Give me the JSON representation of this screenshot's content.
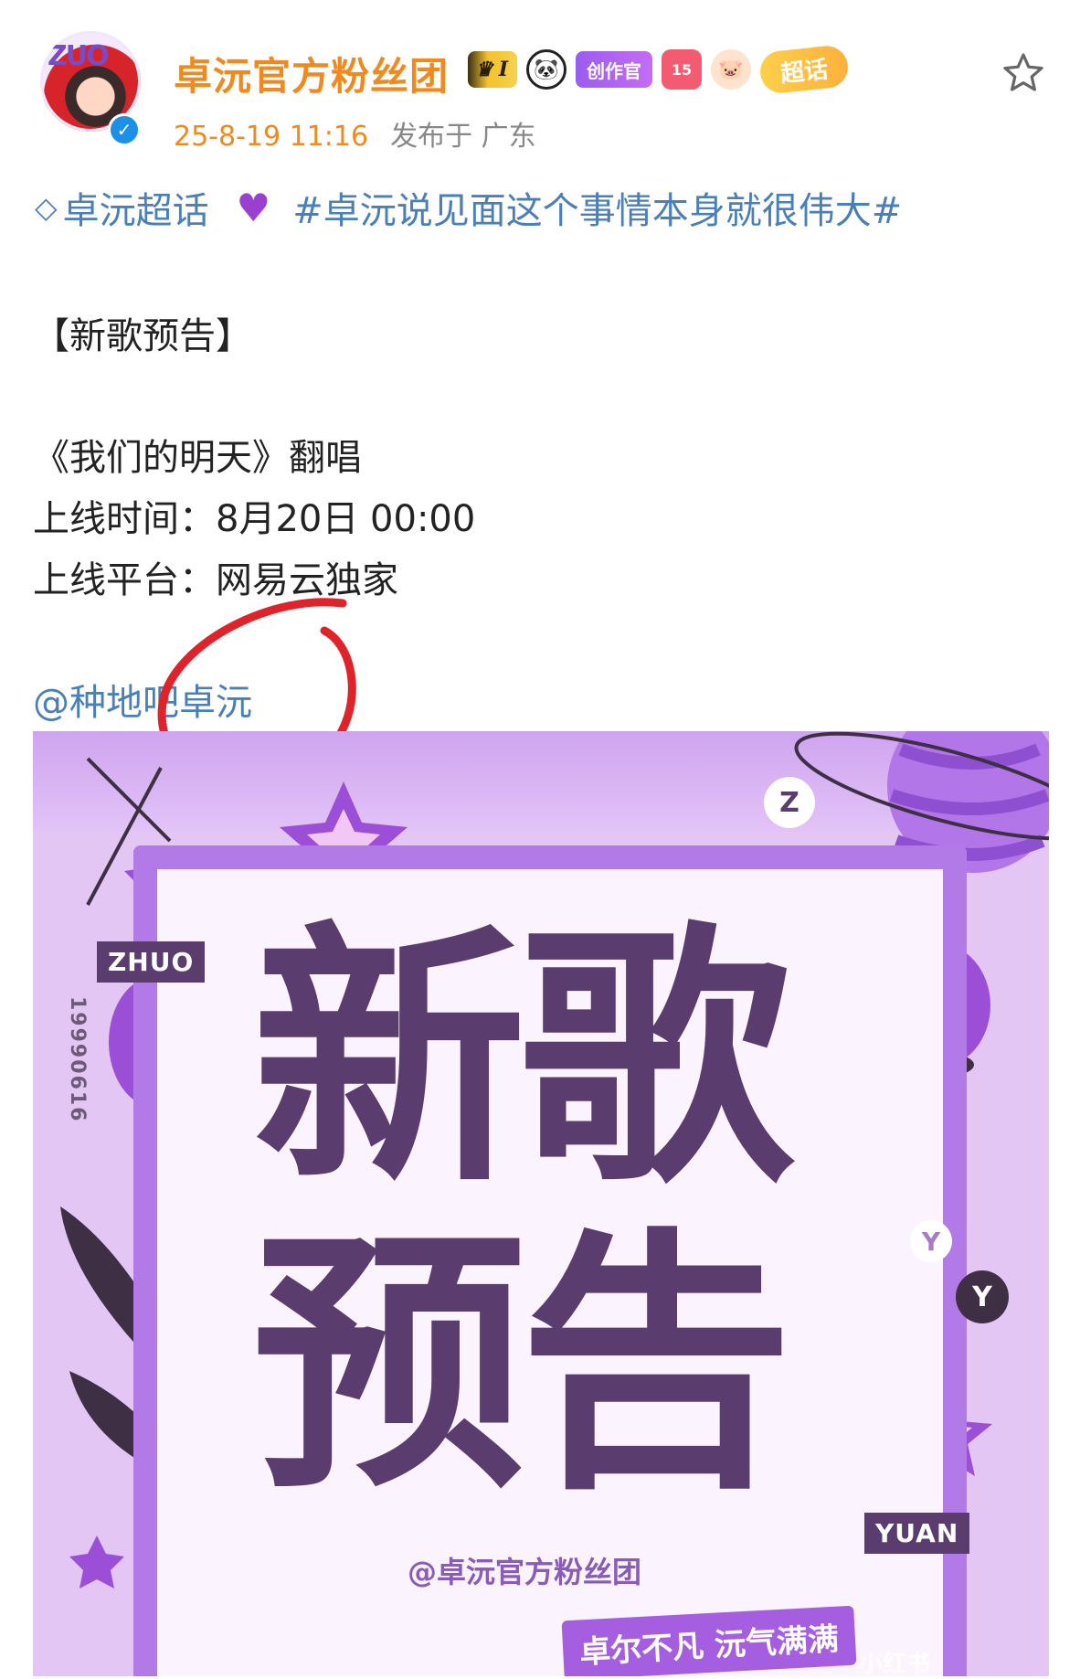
{
  "post": {
    "author": "卓沅官方粉丝团",
    "avatar_text": "ZUO",
    "badges": {
      "crown_level": "I",
      "creator": "创作官",
      "level": "15",
      "supertopic": "超话"
    },
    "datetime": "25-8-19 11:16",
    "location": "发布于 广东",
    "topic_supertopic": "卓沅超话",
    "topic_hashtag": "#卓沅说见面这个事情本身就很伟大#",
    "heading": "【新歌预告】",
    "lines": [
      "《我们的明天》翻唱",
      "上线时间：8月20日 00:00",
      "上线平台：网易云独家"
    ],
    "mention": "@种地吧卓沅"
  },
  "poster": {
    "title_line1": "新歌",
    "title_line2": "预告",
    "tag_left": "ZHUO",
    "tag_right": "YUAN",
    "date_vertical": "19990616",
    "handle": "@卓沅官方粉丝团",
    "slogan": "卓尔不凡 沅气满满",
    "letter_z": "Z",
    "letter_y1": "Y",
    "letter_y2": "Y"
  },
  "icons": {
    "favorite": "star-outline-icon",
    "verified": "verified-icon",
    "supertopic": "diamond-icon",
    "heart": "purple-heart-icon"
  },
  "colors": {
    "author": "#f08a1f",
    "link": "#4a7fb8",
    "poster_bg": "#e3c6f4",
    "poster_text": "#5b3c6e",
    "annotation": "#e0232a"
  },
  "watermark": "小红书"
}
